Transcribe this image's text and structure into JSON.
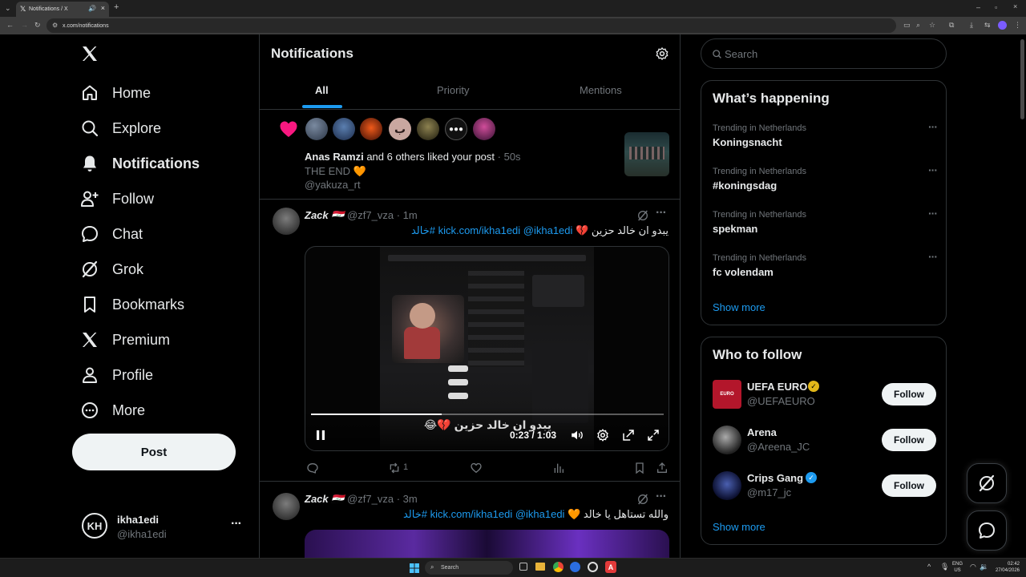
{
  "browser": {
    "tab_title": "Notifications / X",
    "url": "x.com/notifications"
  },
  "nav": {
    "items": [
      {
        "label": "Home",
        "icon": "home-icon"
      },
      {
        "label": "Explore",
        "icon": "search-icon"
      },
      {
        "label": "Notifications",
        "icon": "bell-icon"
      },
      {
        "label": "Follow",
        "icon": "person-add-icon"
      },
      {
        "label": "Chat",
        "icon": "chat-icon"
      },
      {
        "label": "Grok",
        "icon": "grok-icon"
      },
      {
        "label": "Bookmarks",
        "icon": "bookmark-icon"
      },
      {
        "label": "Premium",
        "icon": "x-logo-icon"
      },
      {
        "label": "Profile",
        "icon": "profile-icon"
      },
      {
        "label": "More",
        "icon": "more-circle-icon"
      }
    ],
    "post_label": "Post",
    "account": {
      "name": "ikha1edi",
      "handle": "@ikha1edi"
    }
  },
  "main": {
    "title": "Notifications",
    "tabs": [
      "All",
      "Priority",
      "Mentions"
    ],
    "like_notification": {
      "actor": "Anas Ramzi",
      "text": " and 6 others liked your post",
      "time": "· 50s",
      "post_text": "THE END 🧡",
      "post_handle": "@yakuza_rt"
    },
    "posts": [
      {
        "name": "Zack 🇮🇶",
        "handle": "@zf7_vza",
        "time": "· 1m",
        "text_ar": "يبدو ان خالد حزين 💔",
        "links": "kick.com/ikha1edi @ikha1edi #خالد",
        "video_time": "0:23 / 1:03",
        "video_progress": 0.37,
        "video_caption": "يبدو ان خالد حزين 💔😂",
        "retweets": "1"
      },
      {
        "name": "Zack 🇮🇶",
        "handle": "@zf7_vza",
        "time": "· 3m",
        "text_ar": "والله تستاهل يا خالد 🧡",
        "links": "kick.com/ikha1edi @ikha1edi #خالد"
      }
    ]
  },
  "right": {
    "search_placeholder": "Search",
    "happening_title": "What’s happening",
    "trends": [
      {
        "context": "Trending in Netherlands",
        "name": "Koningsnacht"
      },
      {
        "context": "Trending in Netherlands",
        "name": "#koningsdag"
      },
      {
        "context": "Trending in Netherlands",
        "name": "spekman"
      },
      {
        "context": "Trending in Netherlands",
        "name": "fc volendam"
      }
    ],
    "show_more": "Show more",
    "who_title": "Who to follow",
    "follow_label": "Follow",
    "suggestions": [
      {
        "name": "UEFA EURO",
        "handle": "@UEFAEURO",
        "verified": "gold"
      },
      {
        "name": "Arena",
        "handle": "@Areena_JC",
        "verified": ""
      },
      {
        "name": "Crips Gang",
        "handle": "@m17_jc",
        "verified": "blue"
      }
    ],
    "show_more_2": "Show more"
  },
  "taskbar": {
    "search": "Search",
    "lang": "ENG",
    "region": "US",
    "time": "02:42",
    "date": "27/04/2026"
  },
  "colors": {
    "accent": "#1d9bf0",
    "like_pink": "#f91880",
    "background": "#000000",
    "border": "#2f3336"
  }
}
